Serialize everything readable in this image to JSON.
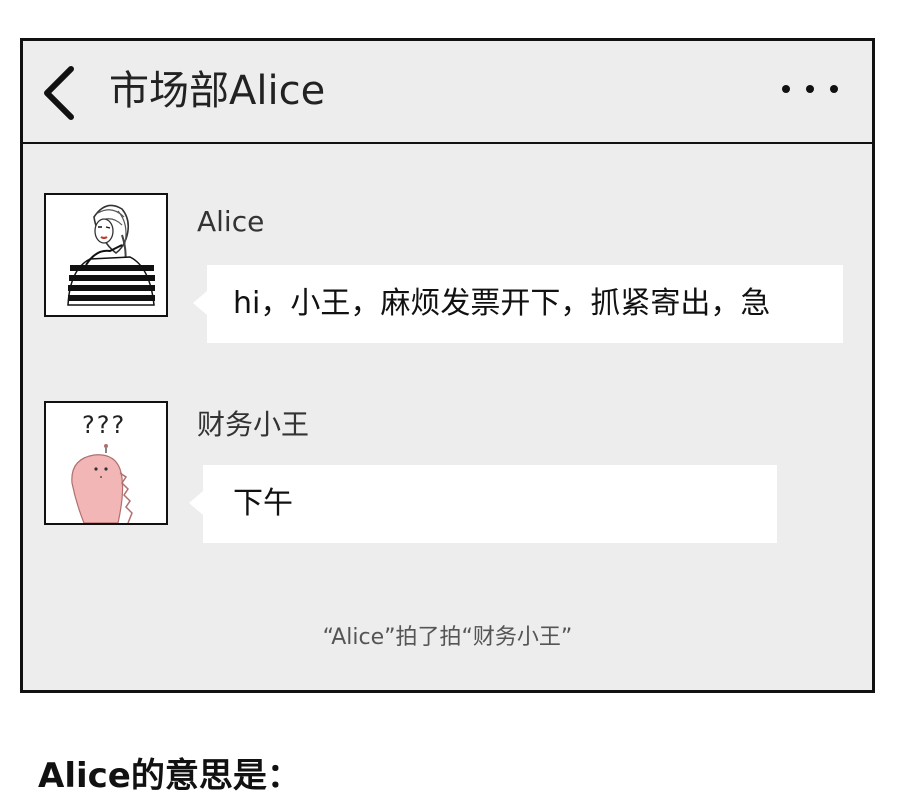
{
  "chat": {
    "title": "市场部Alice",
    "messages": [
      {
        "sender": "Alice",
        "text": "hi，小王，麻烦发票开下，抓紧寄出，急"
      },
      {
        "sender": "财务小王",
        "text": "下午",
        "avatar_text": "???"
      }
    ],
    "system_notice": "“Alice”拍了拍“财务小王”"
  },
  "question": "Alice的意思是：",
  "colors": {
    "chat_bg": "#ededed",
    "bubble_bg": "#ffffff",
    "border": "#111111",
    "dino_pink": "#f2b6b6"
  }
}
